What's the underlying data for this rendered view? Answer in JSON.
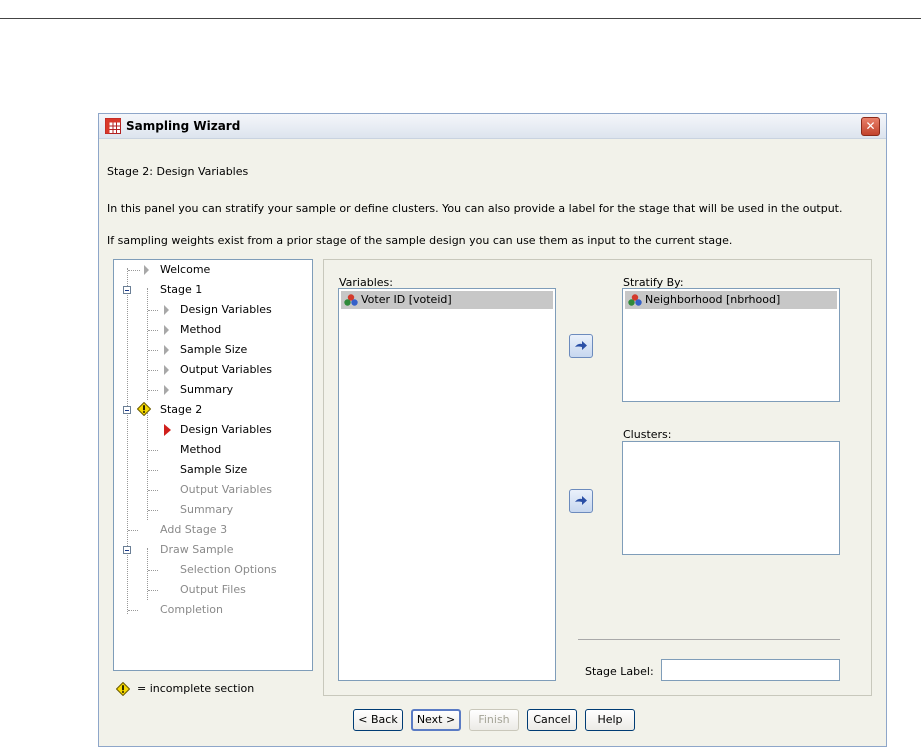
{
  "window": {
    "title": "Sampling Wizard",
    "close_glyph": "✕"
  },
  "header": {
    "stage_heading": "Stage 2: Design Variables",
    "instruction1": "In this panel you can stratify your sample or define clusters. You can also provide a label for the stage that will be used in the output.",
    "instruction2": "If sampling weights exist from a prior stage of the sample design you can use them as input to the current stage."
  },
  "tree": {
    "items": [
      {
        "label": "Welcome"
      },
      {
        "label": "Stage 1"
      },
      {
        "label": "Design Variables"
      },
      {
        "label": "Method"
      },
      {
        "label": "Sample Size"
      },
      {
        "label": "Output Variables"
      },
      {
        "label": "Summary"
      },
      {
        "label": "Stage 2"
      },
      {
        "label": "Design Variables"
      },
      {
        "label": "Method"
      },
      {
        "label": "Sample Size"
      },
      {
        "label": "Output Variables"
      },
      {
        "label": "Summary"
      },
      {
        "label": "Add Stage 3"
      },
      {
        "label": "Draw Sample"
      },
      {
        "label": "Selection Options"
      },
      {
        "label": "Output Files"
      },
      {
        "label": "Completion"
      }
    ],
    "legend": "= incomplete section"
  },
  "variables": {
    "label": "Variables:",
    "items": [
      "Voter ID [voteid]"
    ]
  },
  "stratify": {
    "label": "Stratify By:",
    "items": [
      "Neighborhood [nbrhood]"
    ]
  },
  "clusters": {
    "label": "Clusters:"
  },
  "stage_label": {
    "label": "Stage Label:",
    "value": ""
  },
  "buttons": {
    "back": "< Back",
    "next": "Next >",
    "finish": "Finish",
    "cancel": "Cancel",
    "help": "Help"
  },
  "colors": {
    "current_marker": "#d0201c",
    "warning": "#f5d800",
    "selection": "#c7c7c7"
  }
}
